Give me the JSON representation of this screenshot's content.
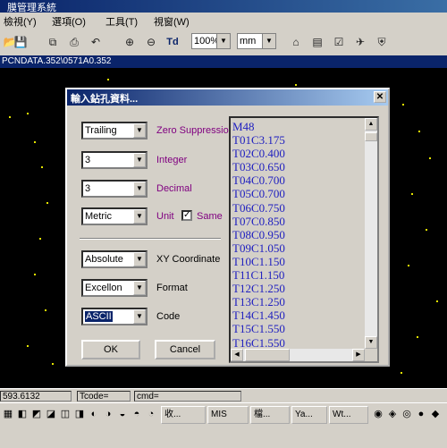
{
  "window": {
    "title": "膜管理系統"
  },
  "menu": [
    "檢視(Y)",
    "選項(O)",
    "工具(T)",
    "視窗(W)"
  ],
  "toolbar": {
    "zoom": "100%",
    "unit": "mm",
    "td_label": "Td"
  },
  "document": {
    "title": "PCNDATA.352\\0571A0.352"
  },
  "dialog": {
    "title": "輸入鉆孔資料...",
    "zero_suppression": {
      "value": "Trailing",
      "label": "Zero Suppression"
    },
    "integer": {
      "value": "3",
      "label": "Integer"
    },
    "decimal": {
      "value": "3",
      "label": "Decimal"
    },
    "unit": {
      "value": "Metric",
      "label": "Unit",
      "same_label": "Same",
      "same_checked": true
    },
    "xy": {
      "value": "Absolute",
      "label": "XY Coordinate"
    },
    "format": {
      "value": "Excellon",
      "label": "Format"
    },
    "code": {
      "value": "ASCII",
      "label": "Code"
    },
    "ok": "OK",
    "cancel": "Cancel",
    "lines": [
      "M48",
      "T01C3.175",
      "T02C0.400",
      "T03C0.650",
      "T04C0.700",
      "T05C0.700",
      "T06C0.750",
      "T07C0.850",
      "T08C0.950",
      "T09C1.050",
      "T10C1.150",
      "T11C1.150",
      "T12C1.250",
      "T13C1.250",
      "T14C1.450",
      "T15C1.550",
      "T16C1.550"
    ]
  },
  "status": {
    "coord": "593.6132",
    "tcode": "Tcode=",
    "cmd": "cmd="
  },
  "taskbar": [
    "收...",
    "MIS",
    "檔...",
    "Ya...",
    "Wt..."
  ],
  "colors": {
    "title_blue": "#0a246a",
    "pad_yellow": "#e4e400",
    "text_blue": "#2020c0",
    "label_purple": "#800080"
  }
}
